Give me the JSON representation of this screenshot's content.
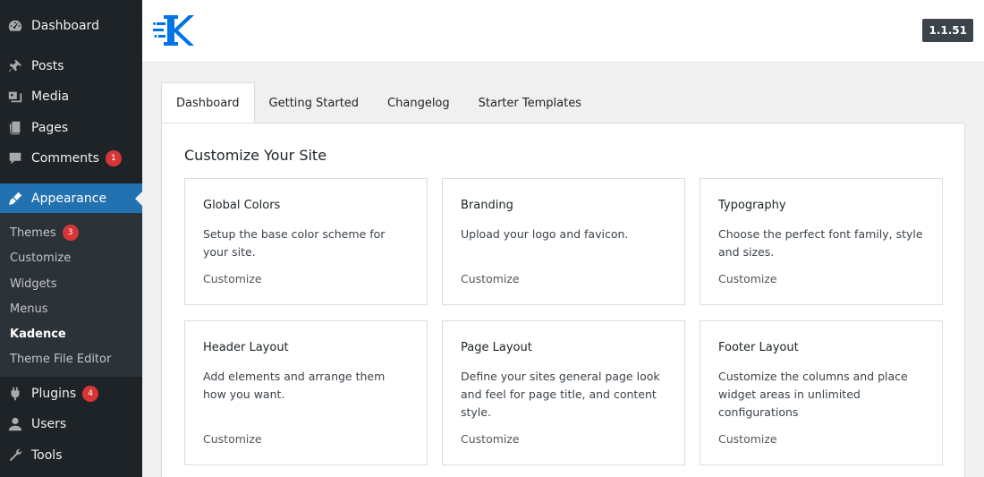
{
  "sidebar": {
    "items": [
      {
        "label": "Dashboard",
        "icon": "dashboard-icon"
      },
      {
        "label": "Posts",
        "icon": "pin-icon"
      },
      {
        "label": "Media",
        "icon": "media-icon"
      },
      {
        "label": "Pages",
        "icon": "pages-icon"
      },
      {
        "label": "Comments",
        "icon": "comment-icon",
        "badge": "1"
      },
      {
        "label": "Appearance",
        "icon": "brush-icon",
        "active": true
      },
      {
        "label": "Plugins",
        "icon": "plugin-icon",
        "badge": "4"
      },
      {
        "label": "Users",
        "icon": "user-icon"
      },
      {
        "label": "Tools",
        "icon": "wrench-icon"
      }
    ],
    "submenu": [
      {
        "label": "Themes",
        "badge": "3"
      },
      {
        "label": "Customize"
      },
      {
        "label": "Widgets"
      },
      {
        "label": "Menus"
      },
      {
        "label": "Kadence",
        "current": true
      },
      {
        "label": "Theme File Editor"
      }
    ]
  },
  "header": {
    "version": "1.1.51",
    "logo_icon": "kadence-logo-icon",
    "accent": "#0073e6"
  },
  "tabs": [
    "Dashboard",
    "Getting Started",
    "Changelog",
    "Starter Templates"
  ],
  "main": {
    "title": "Customize Your Site",
    "cards": [
      {
        "title": "Global Colors",
        "desc": "Setup the base color scheme for your site.",
        "link": "Customize"
      },
      {
        "title": "Branding",
        "desc": "Upload your logo and favicon.",
        "link": "Customize"
      },
      {
        "title": "Typography",
        "desc": "Choose the perfect font family, style and sizes.",
        "link": "Customize"
      },
      {
        "title": "Header Layout",
        "desc": "Add elements and arrange them how you want.",
        "link": "Customize"
      },
      {
        "title": "Page Layout",
        "desc": "Define your sites general page look and feel for page title, and content style.",
        "link": "Customize"
      },
      {
        "title": "Footer Layout",
        "desc": "Customize the columns and place widget areas in unlimited configurations",
        "link": "Customize"
      }
    ]
  }
}
